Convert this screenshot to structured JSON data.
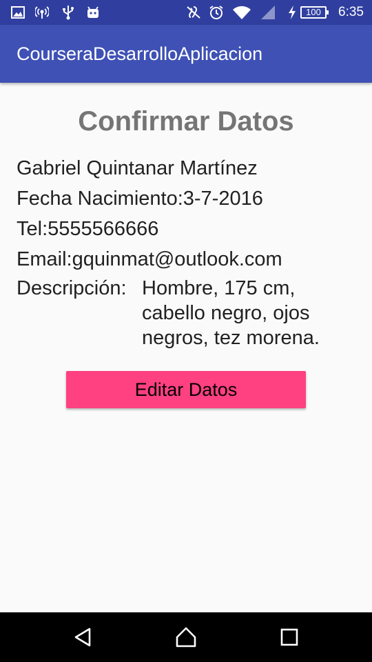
{
  "status_bar": {
    "time": "6:35",
    "battery": "100",
    "icons": [
      "gallery-icon",
      "wifi-hotspot-icon",
      "usb-icon",
      "android-icon",
      "hearing-aid-icon",
      "alarm-icon",
      "wifi-icon",
      "signal-icon",
      "charging-icon",
      "battery-icon"
    ]
  },
  "app_bar": {
    "title": "CourseraDesarrolloAplicacion"
  },
  "main": {
    "title": "Confirmar Datos",
    "name": "Gabriel Quintanar Martínez",
    "birthdate": "Fecha Nacimiento:3-7-2016",
    "phone": "Tel:5555566666",
    "email": "Email:gquinmat@outlook.com",
    "description_label": "Descripción:",
    "description_value": "Hombre, 175 cm, cabello negro, ojos negros, tez morena.",
    "edit_button": "Editar Datos"
  },
  "nav_bar": {
    "icons": [
      "back-icon",
      "home-icon",
      "recents-icon"
    ]
  },
  "colors": {
    "primary": "#3f51b5",
    "primary_dark": "#303f9f",
    "accent": "#ff4081"
  }
}
